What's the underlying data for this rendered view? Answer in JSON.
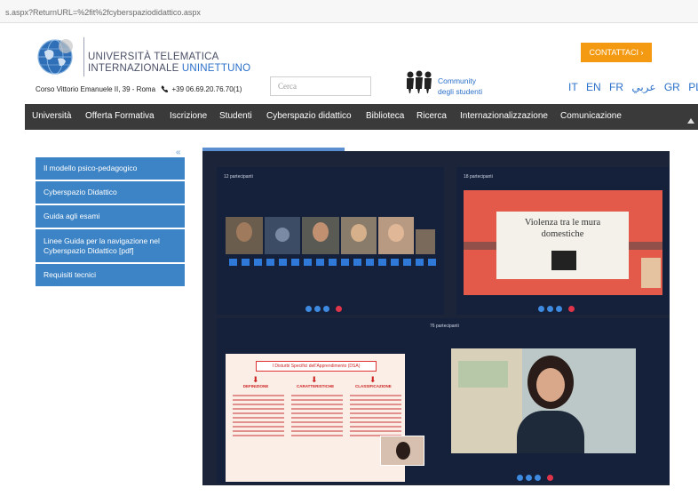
{
  "browser": {
    "url": "s.aspx?ReturnURL=%2fit%2fcyberspaziodidattico.aspx"
  },
  "header": {
    "university_line1": "UNIVERSITÀ TELEMATICA",
    "university_line2_a": "INTERNAZIONALE",
    "university_line2_b": "UNINETTUNO",
    "address": "Corso Vittorio Emanuele II, 39 - Roma",
    "phone": "+39 06.69.20.76.70(1)",
    "search_placeholder": "Cerca",
    "community_line1": "Community",
    "community_line2": "degli studenti",
    "contact_label": "CONTATTACI",
    "languages": [
      "IT",
      "EN",
      "FR",
      "عربي",
      "GR",
      "PL"
    ]
  },
  "nav": {
    "items": [
      "Università",
      "Offerta Formativa",
      "Iscrizione",
      "Studenti",
      "Cyberspazio didattico",
      "Biblioteca",
      "Ricerca",
      "Internazionalizzazione",
      "Comunicazione"
    ]
  },
  "sidebar": {
    "items": [
      {
        "label": "Il modello psico-pedagogico"
      },
      {
        "label": "Cyberspazio Didattico"
      },
      {
        "label": "Guida agli esami"
      },
      {
        "label": "Linee Guida per la navigazione nel Cyberspazio Didattico [pdf]"
      },
      {
        "label": "Requisiti tecnici"
      }
    ]
  },
  "collage": {
    "panel1_count": "12 partecipanti",
    "panel2_count": "18 partecipanti",
    "panel3_count": "76 partecipanti",
    "slide1_title_line1": "Violenza tra le mura",
    "slide1_title_line2": "domestiche",
    "slide2_title": "I Disturbi Specifici dell'Apprendimento (DSA)",
    "slide2_col1": "DEFINIZIONE",
    "slide2_col2": "CARATTERISTICHE",
    "slide2_col3": "CLASSIFICAZIONE"
  },
  "colors": {
    "nav_bg": "#3a3a3a",
    "sidebar_bg": "#3d84c6",
    "contact_bg": "#f39a12",
    "link_blue": "#2a6fc9"
  }
}
